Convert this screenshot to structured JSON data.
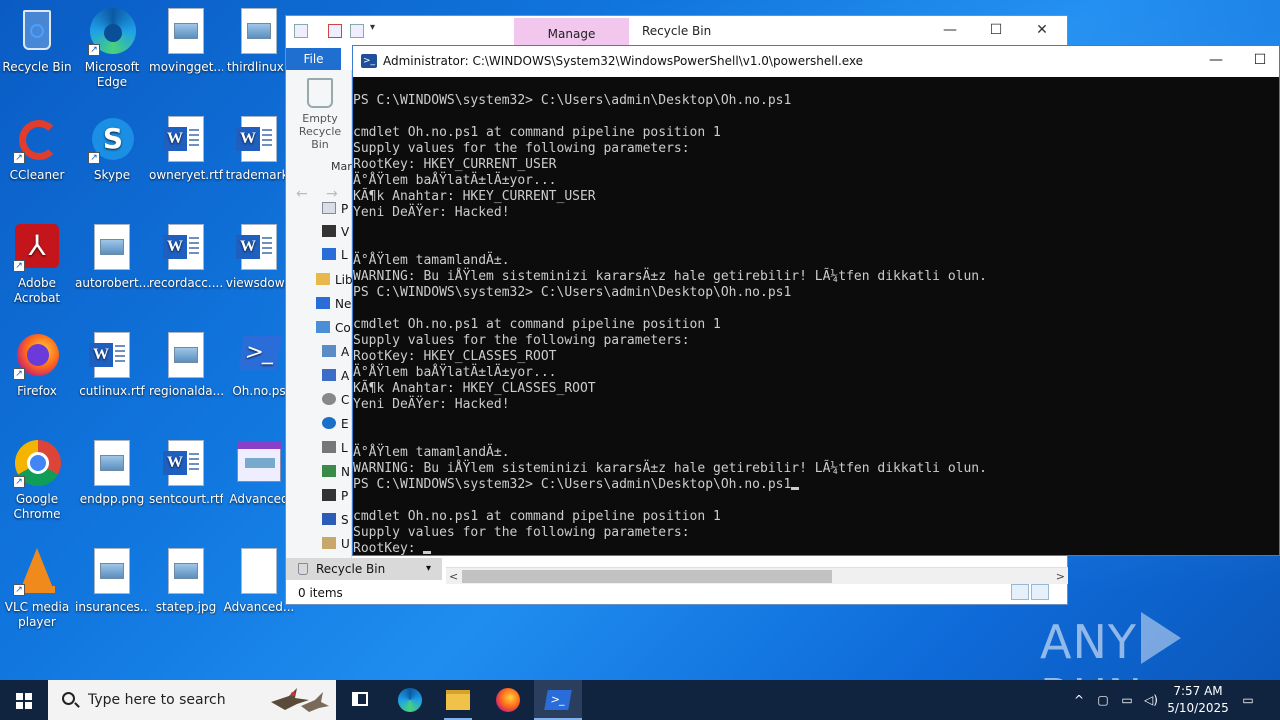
{
  "desktop": {
    "icons": [
      {
        "label": "Recycle Bin",
        "icon": "recycle-bin-icon"
      },
      {
        "label": "Microsoft Edge",
        "icon": "edge-icon"
      },
      {
        "label": "movingget....",
        "icon": "image-file-icon"
      },
      {
        "label": "thirdlinux.j",
        "icon": "image-file-icon"
      },
      {
        "label": "CCleaner",
        "icon": "ccleaner-icon"
      },
      {
        "label": "Skype",
        "icon": "skype-icon"
      },
      {
        "label": "owneryet.rtf",
        "icon": "word-doc-icon"
      },
      {
        "label": "trademark.",
        "icon": "word-doc-icon"
      },
      {
        "label": "Adobe Acrobat",
        "icon": "acrobat-icon"
      },
      {
        "label": "autorobert....",
        "icon": "image-file-icon"
      },
      {
        "label": "recordacc....",
        "icon": "word-doc-icon"
      },
      {
        "label": "viewsdown",
        "icon": "word-doc-icon"
      },
      {
        "label": "Firefox",
        "icon": "firefox-icon"
      },
      {
        "label": "cutlinux.rtf",
        "icon": "word-doc-icon"
      },
      {
        "label": "regionalda...",
        "icon": "image-file-icon"
      },
      {
        "label": "Oh.no.ps",
        "icon": "powershell-script-icon"
      },
      {
        "label": "Google Chrome",
        "icon": "chrome-icon"
      },
      {
        "label": "endpp.png",
        "icon": "image-file-icon"
      },
      {
        "label": "sentcourt.rtf",
        "icon": "word-doc-icon"
      },
      {
        "label": "Advanced",
        "icon": "advanced-app-icon"
      },
      {
        "label": "VLC media player",
        "icon": "vlc-icon"
      },
      {
        "label": "insurances....",
        "icon": "image-file-icon"
      },
      {
        "label": "statep.jpg",
        "icon": "image-file-icon"
      },
      {
        "label": "Advanced...",
        "icon": "blank-file-icon"
      }
    ]
  },
  "explorer": {
    "manage_tab": "Manage",
    "title": "Recycle Bin",
    "file_tab": "File",
    "ribbon_button": "Empty Recycle Bin",
    "ribbon_group": "Mar",
    "nav_items": [
      "P",
      "V",
      "L",
      "Lib",
      "Ne",
      "Co",
      "A",
      "A",
      "C",
      "E",
      "L",
      "N",
      "P",
      "S",
      "U"
    ],
    "selected_nav": "Recycle Bin",
    "status": "0 items"
  },
  "powershell": {
    "title": "Administrator: C:\\WINDOWS\\System32\\WindowsPowerShell\\v1.0\\powershell.exe",
    "lines": [
      "PS C:\\WINDOWS\\system32> C:\\Users\\admin\\Desktop\\Oh.no.ps1",
      "",
      "cmdlet Oh.no.ps1 at command pipeline position 1",
      "Supply values for the following parameters:",
      "RootKey: HKEY_CURRENT_USER",
      "Ä°ÅŸlem baÅŸlatÄ±lÄ±yor...",
      "KÃ¶k Anahtar: HKEY_CURRENT_USER",
      "Yeni DeÄŸer: Hacked!",
      "",
      "",
      "Ä°ÅŸlem tamamlandÄ±.",
      "WARNING: Bu iÅŸlem sisteminizi kararsÄ±z hale getirebilir! LÃ¼tfen dikkatli olun.",
      "PS C:\\WINDOWS\\system32> C:\\Users\\admin\\Desktop\\Oh.no.ps1",
      "",
      "cmdlet Oh.no.ps1 at command pipeline position 1",
      "Supply values for the following parameters:",
      "RootKey: HKEY_CLASSES_ROOT",
      "Ä°ÅŸlem baÅŸlatÄ±lÄ±yor...",
      "KÃ¶k Anahtar: HKEY_CLASSES_ROOT",
      "Yeni DeÄŸer: Hacked!",
      "",
      "",
      "Ä°ÅŸlem tamamlandÄ±.",
      "WARNING: Bu iÅŸlem sisteminizi kararsÄ±z hale getirebilir! LÃ¼tfen dikkatli olun.",
      "PS C:\\WINDOWS\\system32> C:\\Users\\admin\\Desktop\\Oh.no.ps1",
      "",
      "cmdlet Oh.no.ps1 at command pipeline position 1",
      "Supply values for the following parameters:",
      "RootKey: "
    ]
  },
  "watermark": "ANY RUN",
  "taskbar": {
    "search_placeholder": "Type here to search",
    "apps": [
      "task-view-icon",
      "edge-icon",
      "file-explorer-icon",
      "firefox-icon",
      "powershell-icon"
    ],
    "active_app": "powershell-icon",
    "time": "7:57 AM",
    "date": "5/10/2025"
  },
  "colors": {
    "console_bg": "#0c0c0c",
    "console_fg": "#cccccc",
    "manage_tab": "#f1c7ee",
    "file_tab": "#1e6fcf",
    "taskbar": "#10233f"
  }
}
